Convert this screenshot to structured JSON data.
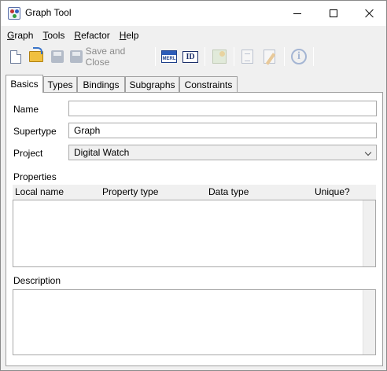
{
  "window": {
    "title": "Graph Tool"
  },
  "menu": [
    {
      "label": "Graph",
      "mnemonic": "G",
      "rest": "raph"
    },
    {
      "label": "Tools",
      "mnemonic": "T",
      "rest": "ools"
    },
    {
      "label": "Refactor",
      "mnemonic": "R",
      "rest": "efactor"
    },
    {
      "label": "Help",
      "mnemonic": "H",
      "rest": "elp"
    }
  ],
  "toolbar": {
    "save_and_close_label": "Save and Close",
    "meril_icon_text": "MERL",
    "id_icon_text": "ID",
    "info_icon_text": "i"
  },
  "tabs": [
    "Basics",
    "Types",
    "Bindings",
    "Subgraphs",
    "Constraints"
  ],
  "active_tab": "Basics",
  "form": {
    "name_label": "Name",
    "name_value": "",
    "supertype_label": "Supertype",
    "supertype_value": "Graph",
    "project_label": "Project",
    "project_value": "Digital Watch",
    "properties_label": "Properties",
    "properties_columns": [
      "Local name",
      "Property type",
      "Data type",
      "Unique?"
    ],
    "description_label": "Description",
    "description_value": ""
  },
  "colors": {
    "window_bg": "#f0f0f0",
    "panel_bg": "#ffffff",
    "border": "#a0a0a0",
    "disabled_text": "#8a8a8a",
    "accent_blue": "#2c5cb8"
  },
  "icons": [
    "app-icon",
    "new-icon",
    "open-icon",
    "save-icon",
    "save-and-close-icon",
    "meril-icon",
    "id-icon",
    "image-icon",
    "document-icon",
    "edit-icon",
    "info-icon"
  ]
}
